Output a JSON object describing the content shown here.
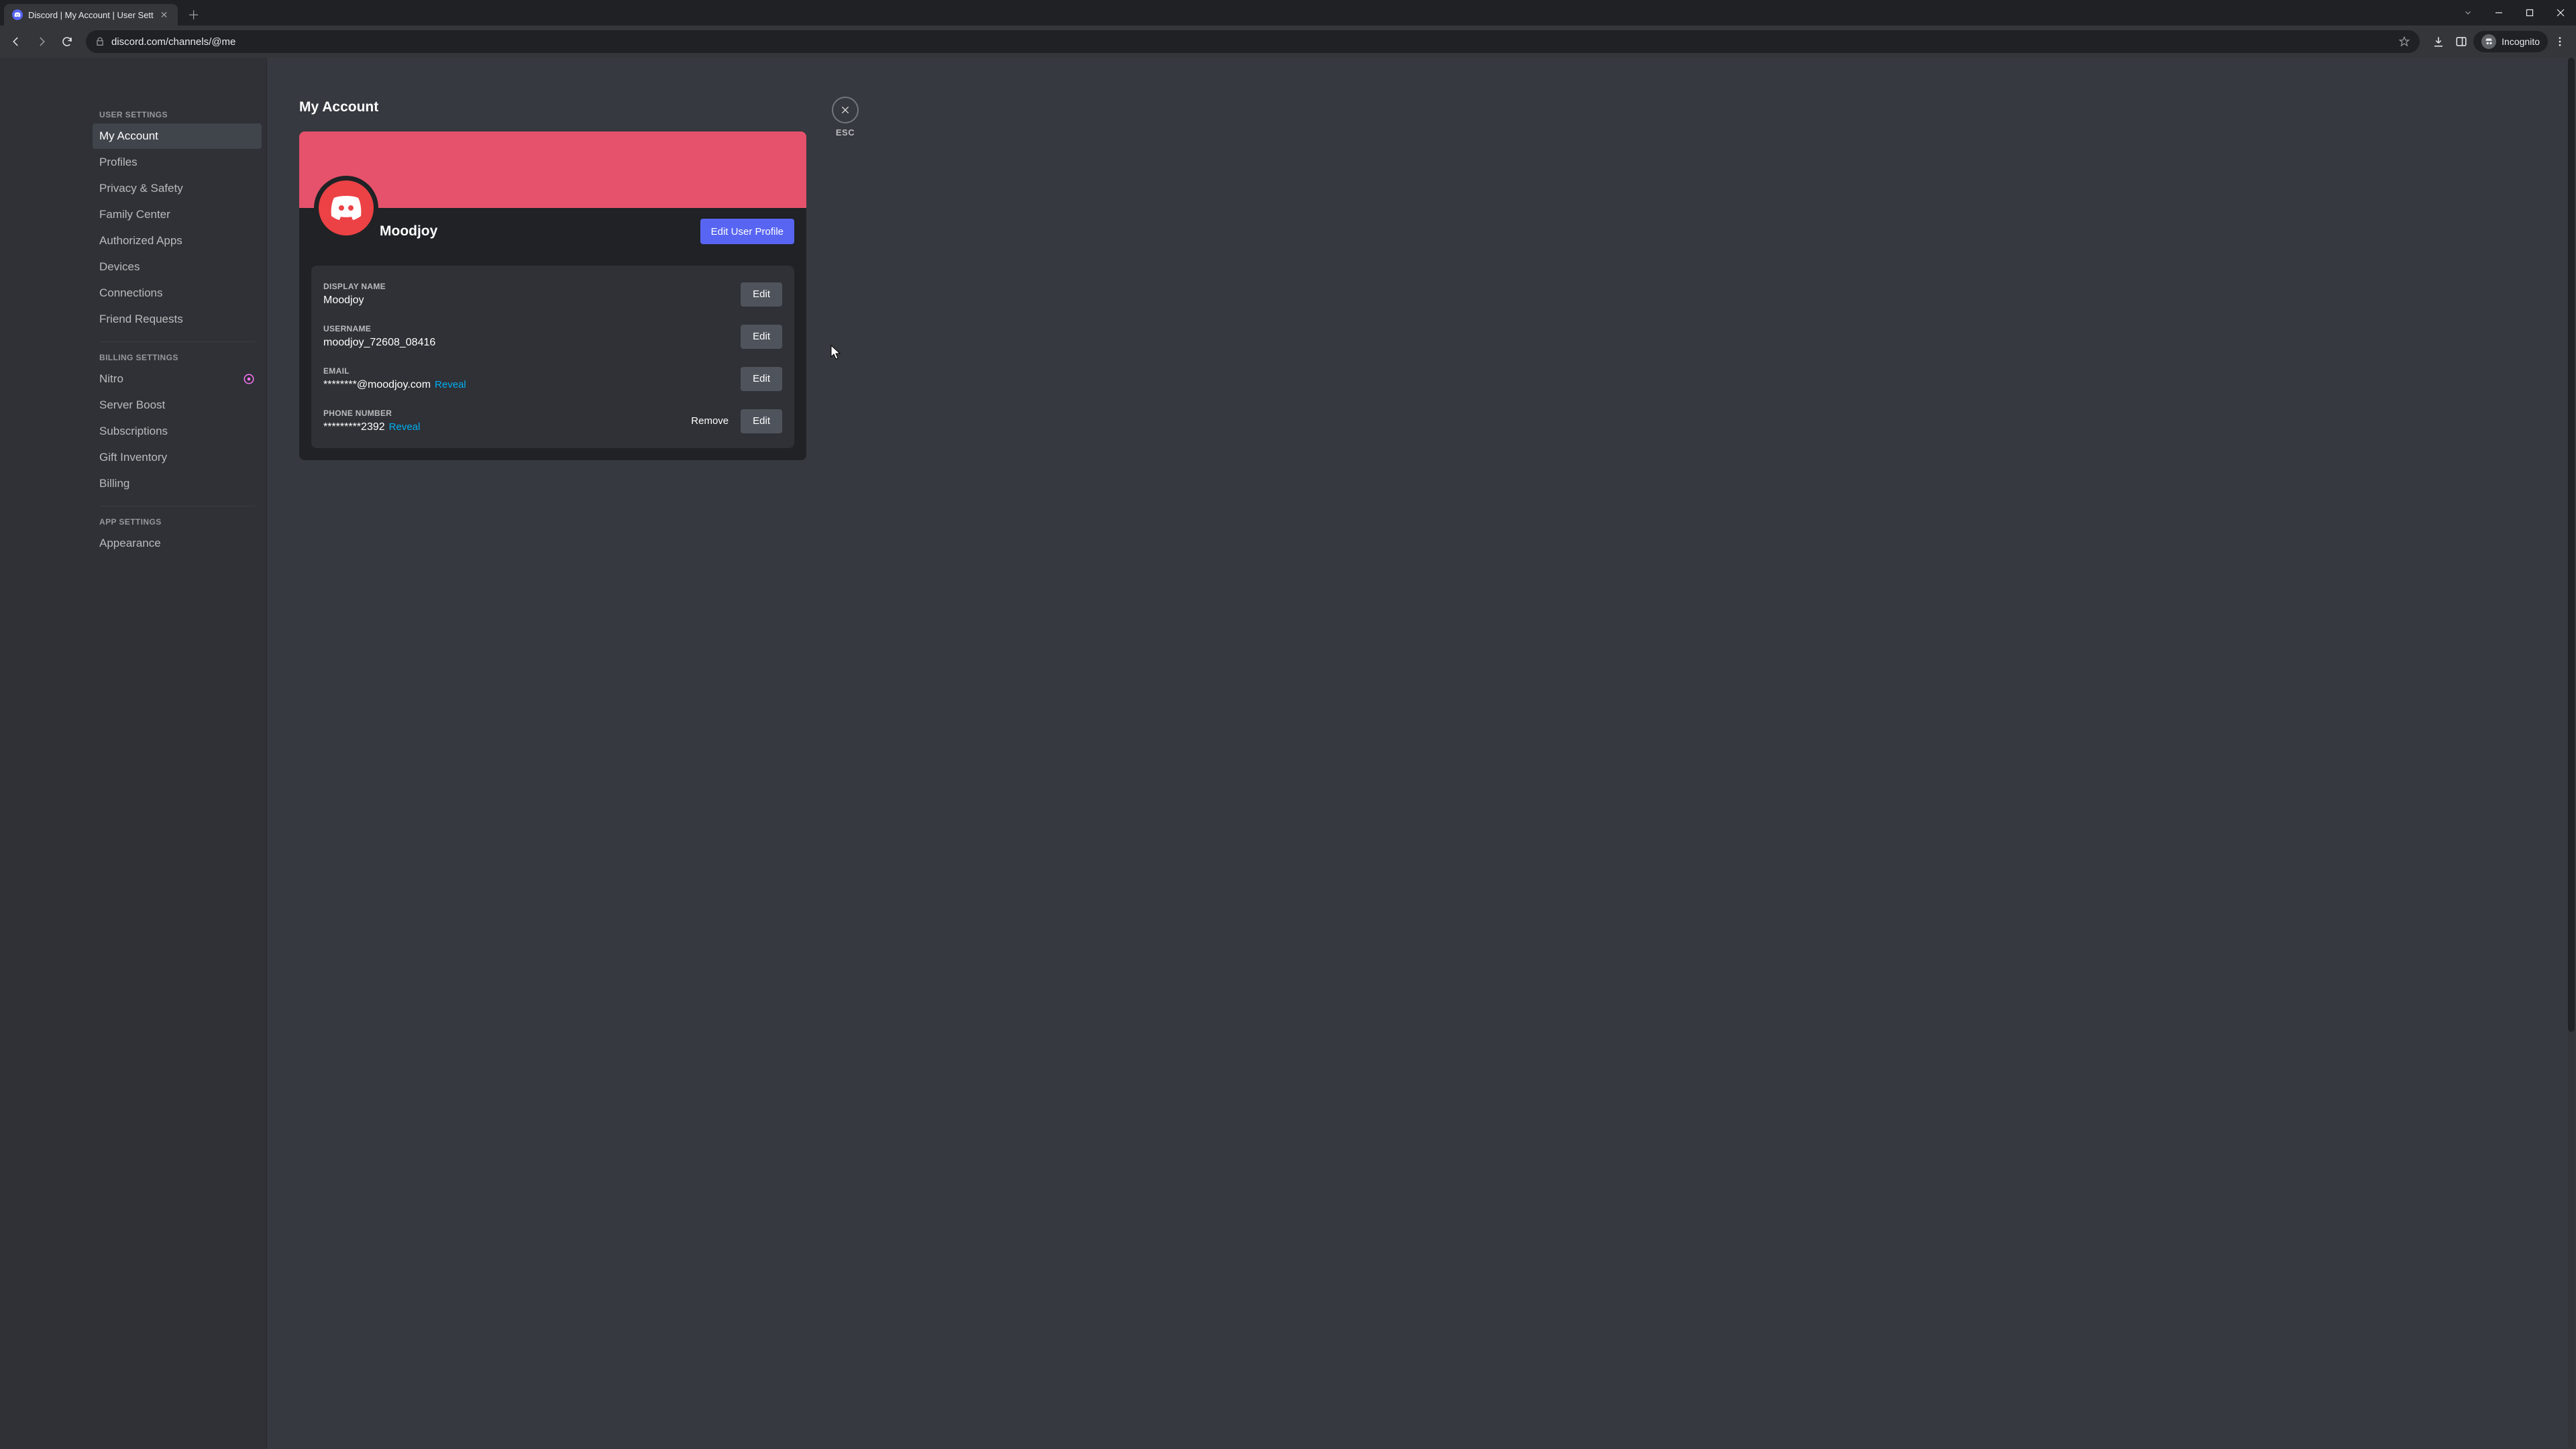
{
  "browser": {
    "tab_title": "Discord | My Account | User Sett",
    "url": "discord.com/channels/@me",
    "incognito_label": "Incognito"
  },
  "close": {
    "esc": "ESC"
  },
  "page": {
    "title": "My Account"
  },
  "sidebar": {
    "groups": [
      {
        "heading": "USER SETTINGS",
        "items": [
          {
            "label": "My Account",
            "active": true
          },
          {
            "label": "Profiles"
          },
          {
            "label": "Privacy & Safety"
          },
          {
            "label": "Family Center"
          },
          {
            "label": "Authorized Apps"
          },
          {
            "label": "Devices"
          },
          {
            "label": "Connections"
          },
          {
            "label": "Friend Requests"
          }
        ]
      },
      {
        "heading": "BILLING SETTINGS",
        "items": [
          {
            "label": "Nitro",
            "badge": true
          },
          {
            "label": "Server Boost"
          },
          {
            "label": "Subscriptions"
          },
          {
            "label": "Gift Inventory"
          },
          {
            "label": "Billing"
          }
        ]
      },
      {
        "heading": "APP SETTINGS",
        "items": [
          {
            "label": "Appearance"
          }
        ]
      }
    ]
  },
  "profile": {
    "display_name": "Moodjoy",
    "edit_profile_btn": "Edit User Profile",
    "banner_color": "#e6526b",
    "avatar_color": "#ec4245"
  },
  "account": {
    "rows": [
      {
        "label": "DISPLAY NAME",
        "value": "Moodjoy",
        "reveal": false,
        "remove": false
      },
      {
        "label": "USERNAME",
        "value": "moodjoy_72608_08416",
        "reveal": false,
        "remove": false
      },
      {
        "label": "EMAIL",
        "value": "********@moodjoy.com",
        "reveal": true,
        "remove": false
      },
      {
        "label": "PHONE NUMBER",
        "value": "*********2392",
        "reveal": true,
        "remove": true
      }
    ],
    "reveal_label": "Reveal",
    "edit_label": "Edit",
    "remove_label": "Remove"
  }
}
